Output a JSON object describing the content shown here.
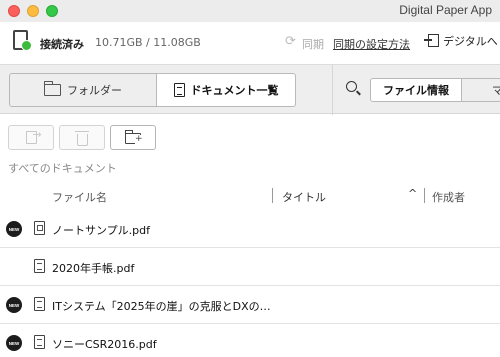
{
  "window": {
    "title": "Digital Paper App"
  },
  "status": {
    "connection": "接続済み",
    "storage": "10.71GB / 11.08GB",
    "sync_label": "同期",
    "sync_settings": "同期の設定方法",
    "digital_button": "デジタルへ"
  },
  "toolbar": {
    "folder_tab": "フォルダー",
    "documents_tab": "ドキュメント一覧",
    "file_info_tab": "ファイル情報",
    "more_tab": "マ"
  },
  "list": {
    "section_label": "すべてのドキュメント",
    "columns": {
      "file_name": "ファイル名",
      "title": "タイトル",
      "author": "作成者"
    },
    "sort_indicator": "^",
    "new_badge": "NEW",
    "rows": [
      {
        "name": "ノートサンプル.pdf",
        "is_new": true
      },
      {
        "name": "2020年手帳.pdf",
        "is_new": false
      },
      {
        "name": "ITシステム「2025年の崖」の克服とDXの…",
        "is_new": true
      },
      {
        "name": "ソニーCSR2016.pdf",
        "is_new": true
      }
    ]
  },
  "colors": {
    "connected": "#3cbc3c",
    "badge": "#1c1c1c",
    "toolbar_bg": "#eeeeee"
  }
}
